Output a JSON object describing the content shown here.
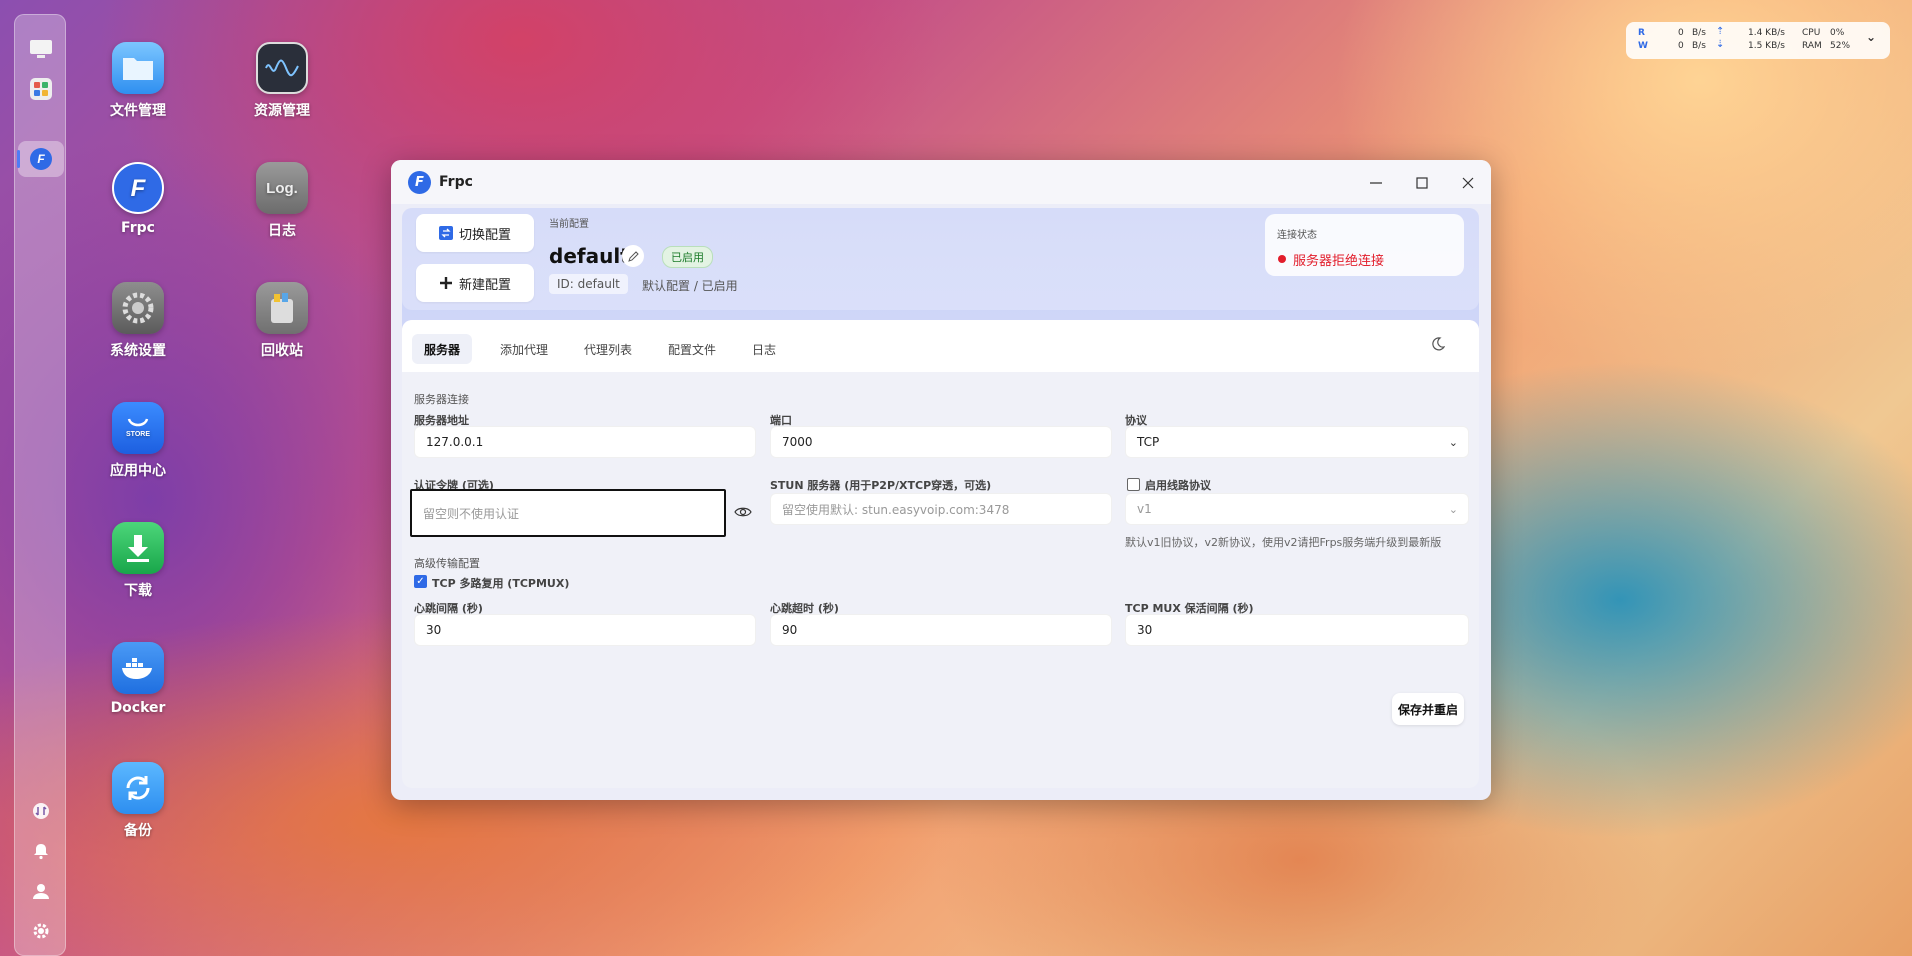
{
  "desktop": {
    "icons": [
      {
        "label": "文件管理",
        "icon": "folder-icon"
      },
      {
        "label": "资源管理",
        "icon": "activity-monitor-icon"
      },
      {
        "label": "Frpc",
        "icon": "frpc-logo-icon"
      },
      {
        "label": "日志",
        "icon": "log-icon"
      },
      {
        "label": "系统设置",
        "icon": "gear-icon"
      },
      {
        "label": "回收站",
        "icon": "trash-icon"
      },
      {
        "label": "应用中心",
        "icon": "store-icon"
      },
      {
        "label": "下载",
        "icon": "download-icon"
      },
      {
        "label": "Docker",
        "icon": "docker-icon"
      },
      {
        "label": "备份",
        "icon": "backup-icon"
      }
    ],
    "log_icon_text": "Log.",
    "store_icon_text": "STORE"
  },
  "stats": {
    "r_label": "R",
    "w_label": "W",
    "r_value": "0",
    "w_value": "0",
    "r_unit": "B/s",
    "w_unit": "B/s",
    "up_speed": "1.4 KB/s",
    "down_speed": "1.5 KB/s",
    "cpu_label": "CPU",
    "ram_label": "RAM",
    "cpu_value": "0%",
    "ram_value": "52%"
  },
  "window": {
    "title": "Frpc",
    "switch_config": "切换配置",
    "new_config": "新建配置",
    "current_config_label": "当前配置",
    "config_name": "default",
    "enabled_badge": "已启用",
    "config_id": "ID: default",
    "config_meta": "默认配置 / 已启用",
    "conn_status_label": "连接状态",
    "conn_status_value": "服务器拒绝连接",
    "tabs": [
      "服务器",
      "添加代理",
      "代理列表",
      "配置文件",
      "日志"
    ],
    "section_server": "服务器连接",
    "server_addr_label": "服务器地址",
    "server_addr_value": "127.0.0.1",
    "port_label": "端口",
    "port_value": "7000",
    "protocol_label": "协议",
    "protocol_value": "TCP",
    "token_label": "认证令牌 (可选)",
    "token_placeholder": "留空则不使用认证",
    "stun_label": "STUN 服务器 (用于P2P/XTCP穿透，可选)",
    "stun_placeholder": "留空使用默认: stun.easyvoip.com:3478",
    "wire_protocol_label": "启用线路协议",
    "wire_protocol_value": "v1",
    "wire_protocol_hint": "默认v1旧协议，v2新协议，使用v2请把Frps服务端升级到最新版",
    "section_advanced": "高级传输配置",
    "tcpmux_label": "TCP 多路复用 (TCPMUX)",
    "heartbeat_interval_label": "心跳间隔 (秒)",
    "heartbeat_interval_value": "30",
    "heartbeat_timeout_label": "心跳超时 (秒)",
    "heartbeat_timeout_value": "90",
    "tcpmux_keepalive_label": "TCP MUX 保活间隔 (秒)",
    "tcpmux_keepalive_value": "30",
    "save_button": "保存并重启"
  },
  "colors": {
    "accent": "#2f6ae6",
    "error": "#e21d2b",
    "success": "#1c7b2a"
  }
}
